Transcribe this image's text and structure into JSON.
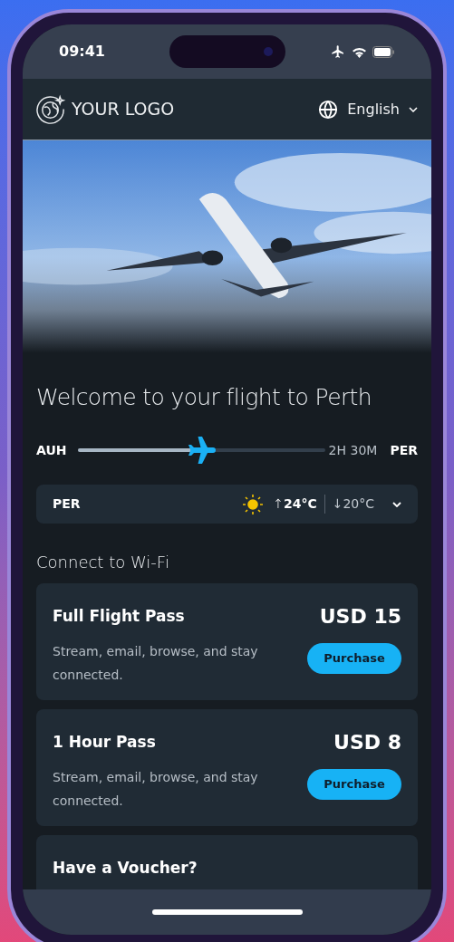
{
  "status_bar": {
    "time": "09:41"
  },
  "header": {
    "logo": "YOUR LOGO",
    "language": "English"
  },
  "flight": {
    "title": "Welcome to your flight to Perth",
    "origin": "AUH",
    "destination": "PER",
    "remaining": "2H 30M",
    "level": 0.5
  },
  "weather": {
    "city": "PER",
    "high_arrow": "↑",
    "high": "24°C",
    "low_arrow": "↓",
    "low": "20°C",
    "expanded": false
  },
  "wifi": {
    "heading": "Connect to Wi-Fi",
    "passes": [
      {
        "name": "Full Flight Pass",
        "price": "USD 15",
        "description": "Stream, email, browse, and stay connected.",
        "button": "Purchase"
      },
      {
        "name": "1 Hour Pass",
        "price": "USD 8",
        "description": "Stream, email, browse, and stay connected.",
        "button": "Purchase"
      }
    ]
  },
  "voucher": {
    "title": "Have a Voucher?"
  }
}
